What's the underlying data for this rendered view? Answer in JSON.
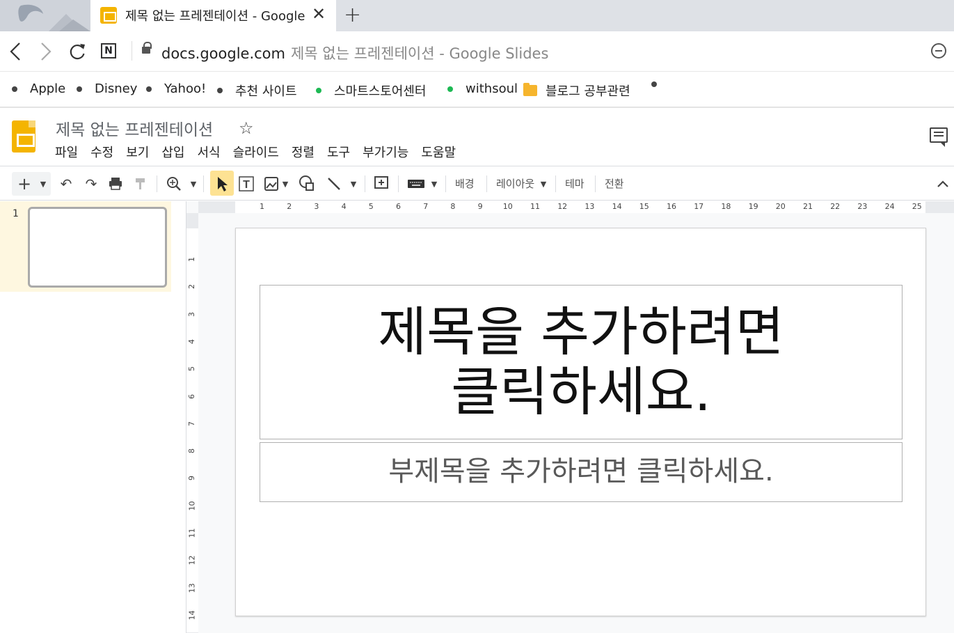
{
  "browser": {
    "tab": {
      "title": "제목 없는 프레젠테이션 - Google Slides",
      "close": "✕"
    },
    "new_tab": "+",
    "address": {
      "domain": "docs.google.com",
      "page_title": "제목 없는 프레젠테이션 - Google Slides"
    },
    "nav": {
      "back": "‹",
      "forward": "›",
      "reload": "↻",
      "notion": "N"
    }
  },
  "bookmarks": [
    {
      "label": "Apple"
    },
    {
      "label": "Disney"
    },
    {
      "label": "Yahoo!"
    },
    {
      "label": "추천 사이트"
    },
    {
      "label": "스마트스토어센터"
    },
    {
      "label": "withsoul"
    },
    {
      "label": "블로그 공부관련"
    }
  ],
  "docs": {
    "title": "제목 없는 프레젠테이션",
    "star": "☆",
    "menu": [
      "파일",
      "수정",
      "보기",
      "삽입",
      "서식",
      "슬라이드",
      "정렬",
      "도구",
      "부가기능",
      "도움말"
    ]
  },
  "toolbar": {
    "new": "+",
    "undo": "↶",
    "redo": "↷",
    "background": "배경",
    "layout": "레이아웃",
    "theme": "테마",
    "transition": "전환",
    "collapse": "⌃"
  },
  "filmstrip": {
    "slide_number": "1"
  },
  "ruler": {
    "horizontal": [
      "1",
      "2",
      "3",
      "4",
      "5",
      "6",
      "7",
      "8",
      "9",
      "10",
      "11",
      "12",
      "13",
      "14",
      "15",
      "16",
      "17",
      "18",
      "19",
      "20",
      "21",
      "22",
      "23",
      "24",
      "25"
    ],
    "vertical": [
      "1",
      "2",
      "3",
      "4",
      "5",
      "6",
      "7",
      "8",
      "9",
      "10",
      "11",
      "12",
      "13",
      "14"
    ]
  },
  "slide": {
    "title_placeholder": "제목을 추가하려면\n클릭하세요.",
    "subtitle_placeholder": "부제목을 추가하려면 클릭하세요."
  },
  "colors": {
    "slides_yellow": "#f4b400",
    "selected_tool": "#fde293",
    "filmstrip_selected": "#fef7e0"
  }
}
